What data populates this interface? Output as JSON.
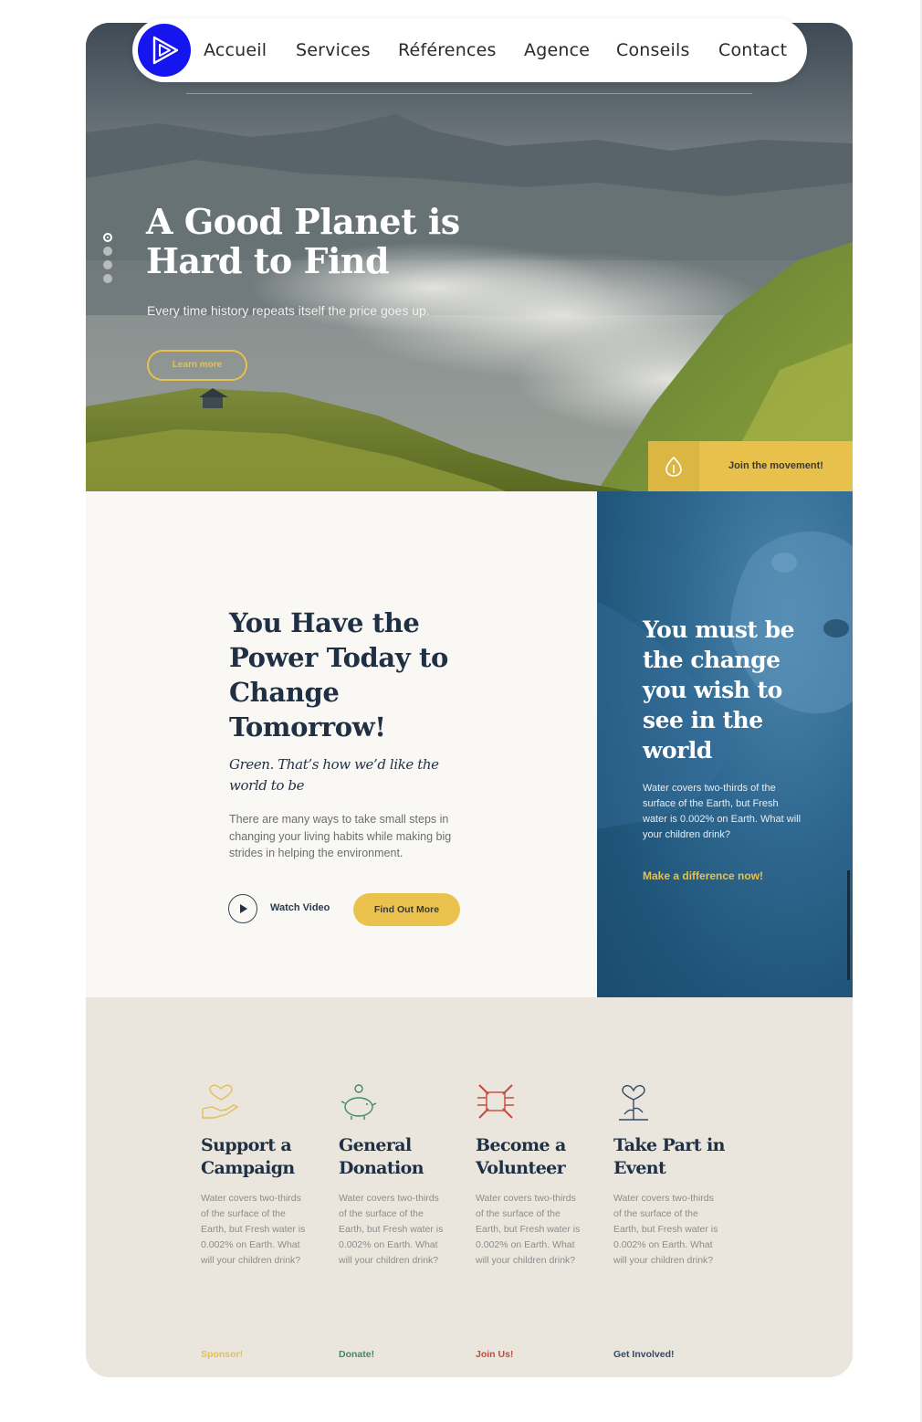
{
  "nav": {
    "logo_name": "play-logo-icon",
    "items": [
      "Accueil",
      "Services",
      "Références",
      "Agence",
      "Conseils",
      "Contact"
    ]
  },
  "hero": {
    "title": "A Good Planet is Hard to Find",
    "subtitle": "Every time history repeats itself the price goes up.",
    "button": "Learn more",
    "slides_total": 4,
    "slide_active": 1,
    "join_label": "Join the movement!"
  },
  "power": {
    "title": "You Have the Power Today to Change Tomorrow!",
    "subtitle": "Green. That’s how we’d like the world to be",
    "text": "There are many ways to take small steps in changing your living habits while making big strides in helping the environment.",
    "watch_label": "Watch Video",
    "button": "Find Out More"
  },
  "change": {
    "title": "You must be the change you wish to see in the world",
    "text": "Water covers two-thirds of the surface of the Earth, but Fresh water is 0.002% on Earth. What will your children drink?",
    "link": "Make a difference now!"
  },
  "ways": [
    {
      "title": "Support a Campaign",
      "text": "Water covers two-thirds of the surface of the Earth, but Fresh water is 0.002% on Earth. What will your children drink?",
      "link": "Sponsor!",
      "color": "#e2bf56",
      "icon": "heart-hand-icon"
    },
    {
      "title": "General Donation",
      "text": "Water covers two-thirds of the surface of the Earth, but Fresh water is 0.002% on Earth. What will your children drink?",
      "link": "Donate!",
      "color": "#3f8a66",
      "icon": "piggy-bank-icon"
    },
    {
      "title": "Become a Volunteer",
      "text": "Water covers two-thirds of the surface of the Earth, but Fresh water is 0.002% on Earth. What will your children drink?",
      "link": "Join Us!",
      "color": "#c8493a",
      "icon": "joined-hands-icon"
    },
    {
      "title": "Take Part in Event",
      "text": "Water covers two-thirds of the surface of the Earth, but Fresh water is 0.002% on Earth. What will your children drink?",
      "link": "Get Involved!",
      "color": "#2f4a66",
      "icon": "heart-flower-icon"
    }
  ],
  "colors": {
    "accent": "#e8c14d",
    "navy": "#1f3045",
    "logo": "#1515f0",
    "teal": "#1f5478"
  }
}
